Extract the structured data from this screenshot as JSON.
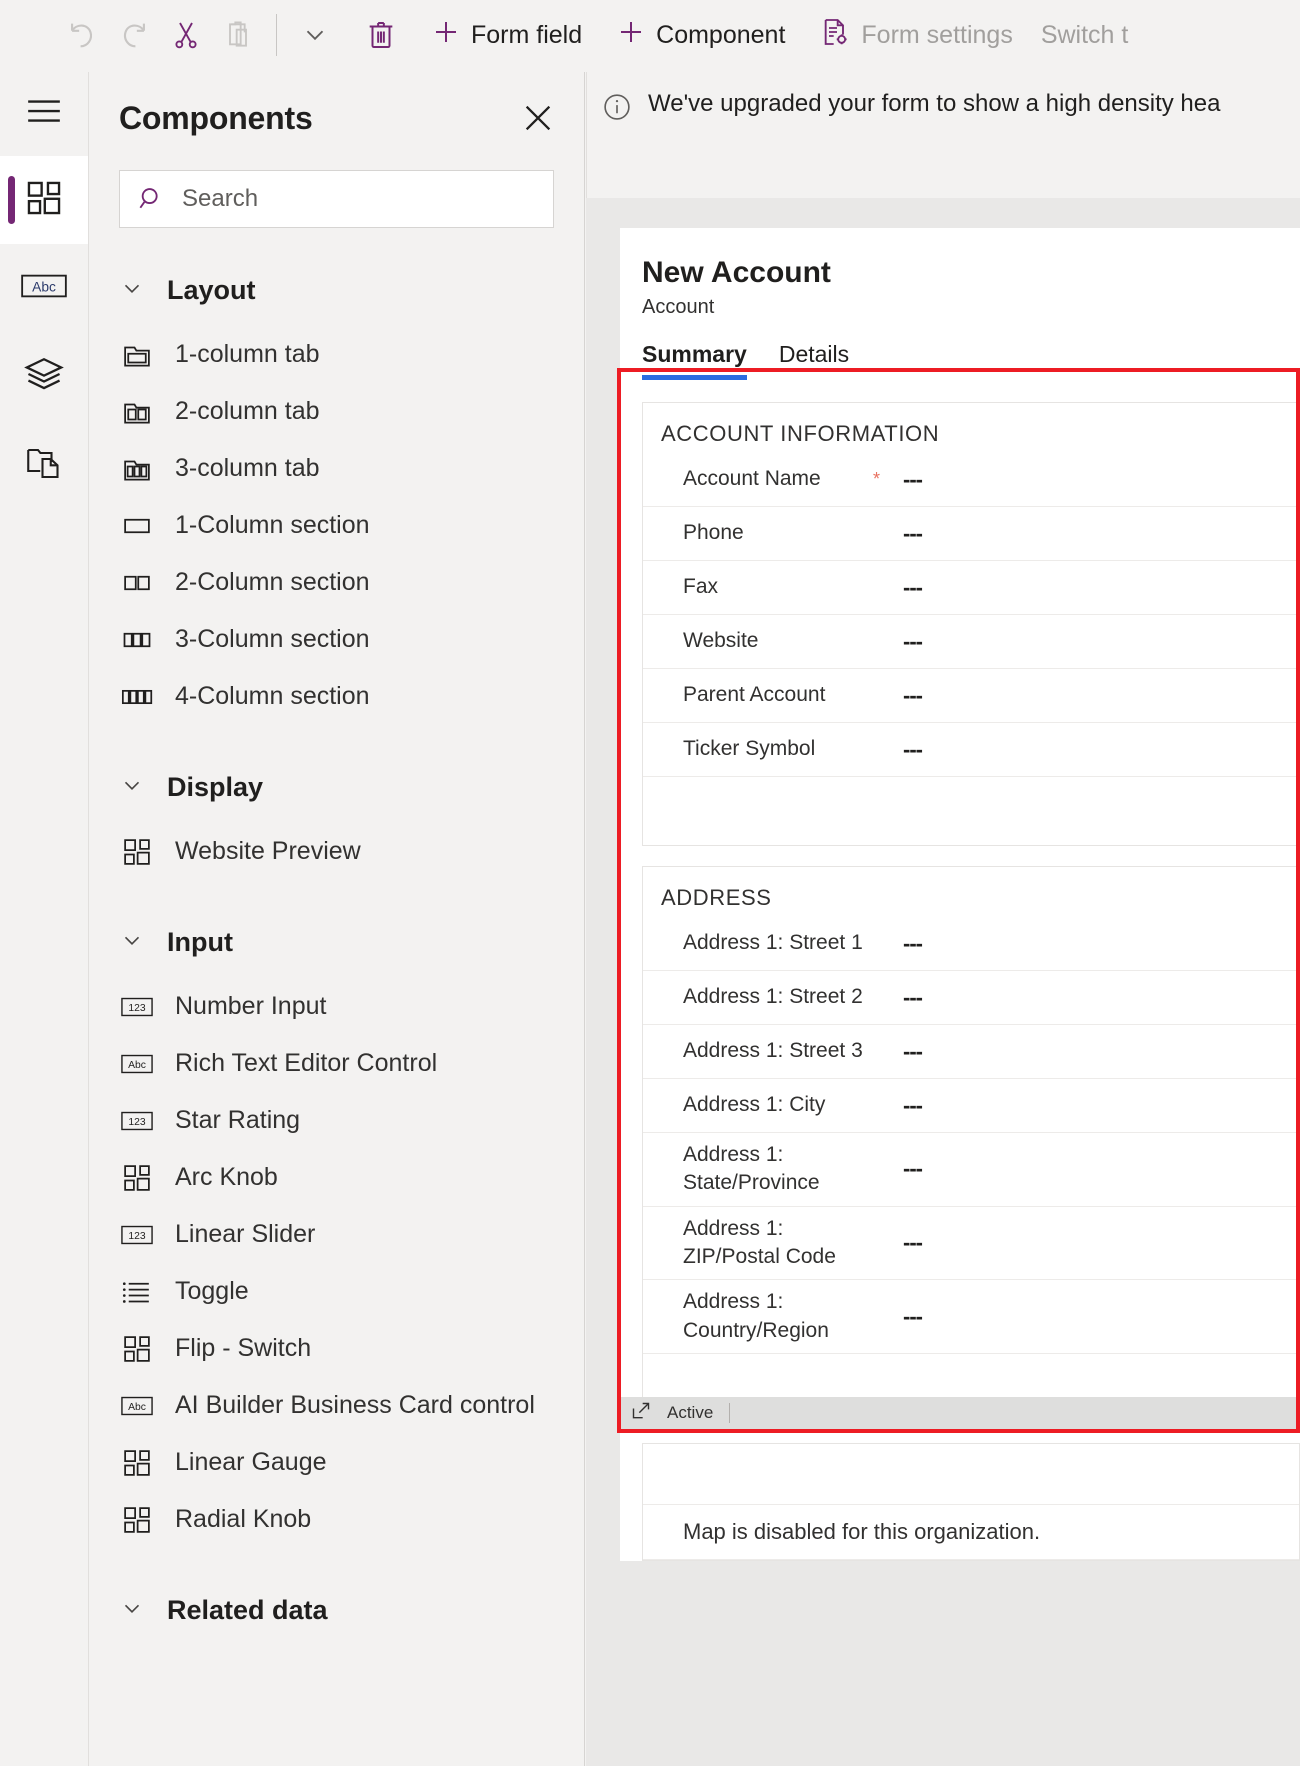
{
  "commandbar": {
    "items": [
      {
        "name": "undo",
        "icon": "undo-icon",
        "label": "",
        "disabled": true
      },
      {
        "name": "redo",
        "icon": "redo-icon",
        "label": "",
        "disabled": true
      },
      {
        "name": "cut",
        "icon": "scissors-icon",
        "label": "",
        "disabled": false
      },
      {
        "name": "paste",
        "icon": "clipboard-icon",
        "label": "",
        "disabled": true
      },
      {
        "name": "overflow",
        "icon": "chevron-down-icon",
        "label": "",
        "disabled": false
      },
      {
        "name": "delete",
        "icon": "trash-icon",
        "label": "",
        "disabled": false
      }
    ],
    "form_field_label": "Form field",
    "component_label": "Component",
    "form_settings_label": "Form settings",
    "switch_label": "Switch t"
  },
  "rail": {
    "items": [
      {
        "name": "hamburger",
        "icon": "hamburger-icon",
        "active": false
      },
      {
        "name": "components",
        "icon": "components-grid-icon",
        "active": true
      },
      {
        "name": "fields",
        "icon": "abc-box-icon",
        "active": false
      },
      {
        "name": "tree-view",
        "icon": "layers-icon",
        "active": false
      },
      {
        "name": "form-library",
        "icon": "copy-folder-icon",
        "active": false
      }
    ]
  },
  "panel": {
    "title": "Components",
    "close_label": "",
    "search": {
      "placeholder": "Search",
      "value": ""
    },
    "groups": [
      {
        "title": "Layout",
        "items": [
          {
            "label": "1-column tab",
            "icon": "tab-1col-icon"
          },
          {
            "label": "2-column tab",
            "icon": "tab-2col-icon"
          },
          {
            "label": "3-column tab",
            "icon": "tab-3col-icon"
          },
          {
            "label": "1-Column section",
            "icon": "section-1col-icon"
          },
          {
            "label": "2-Column section",
            "icon": "section-2col-icon"
          },
          {
            "label": "3-Column section",
            "icon": "section-3col-icon"
          },
          {
            "label": "4-Column section",
            "icon": "section-4col-icon"
          }
        ]
      },
      {
        "title": "Display",
        "items": [
          {
            "label": "Website Preview",
            "icon": "components-grid-icon"
          }
        ]
      },
      {
        "title": "Input",
        "items": [
          {
            "label": "Number Input",
            "icon": "numeric-123-icon"
          },
          {
            "label": "Rich Text Editor Control",
            "icon": "abc-box-icon"
          },
          {
            "label": "Star Rating",
            "icon": "numeric-123-icon"
          },
          {
            "label": "Arc Knob",
            "icon": "components-grid-icon"
          },
          {
            "label": "Linear Slider",
            "icon": "numeric-123-icon"
          },
          {
            "label": "Toggle",
            "icon": "list-lines-icon"
          },
          {
            "label": "Flip - Switch",
            "icon": "components-grid-icon"
          },
          {
            "label": "AI Builder Business Card control",
            "icon": "abc-box-icon"
          },
          {
            "label": "Linear Gauge",
            "icon": "components-grid-icon"
          },
          {
            "label": "Radial Knob",
            "icon": "components-grid-icon"
          }
        ]
      },
      {
        "title": "Related data",
        "items": []
      }
    ]
  },
  "canvas": {
    "notification": {
      "icon": "info-circle-icon",
      "text": "We've upgraded your form to show a high density hea"
    },
    "form": {
      "title": "New Account",
      "subtitle": "Account",
      "tabs": [
        {
          "label": "Summary",
          "active": true
        },
        {
          "label": "Details",
          "active": false
        }
      ],
      "sections": [
        {
          "title": "ACCOUNT INFORMATION",
          "rows": [
            {
              "label": "Account Name",
              "required": "*",
              "value": "---"
            },
            {
              "label": "Phone",
              "required": "",
              "value": "---"
            },
            {
              "label": "Fax",
              "required": "",
              "value": "---"
            },
            {
              "label": "Website",
              "required": "",
              "value": "---"
            },
            {
              "label": "Parent Account",
              "required": "",
              "value": "---"
            },
            {
              "label": "Ticker Symbol",
              "required": "",
              "value": "---"
            }
          ]
        },
        {
          "title": "ADDRESS",
          "rows": [
            {
              "label": "Address 1: Street 1",
              "required": "",
              "value": "---"
            },
            {
              "label": "Address 1: Street 2",
              "required": "",
              "value": "---"
            },
            {
              "label": "Address 1: Street 3",
              "required": "",
              "value": "---"
            },
            {
              "label": "Address 1: City",
              "required": "",
              "value": "---"
            },
            {
              "label": "Address 1: State/Province",
              "required": "",
              "value": "---"
            },
            {
              "label": "Address 1: ZIP/Postal Code",
              "required": "",
              "value": "---"
            },
            {
              "label": "Address 1: Country/Region",
              "required": "",
              "value": "---"
            }
          ]
        }
      ],
      "map_message": "Map is disabled for this organization."
    },
    "statusbar": {
      "icon": "popout-icon",
      "state": "Active"
    }
  },
  "colors": {
    "accent_purple": "#742774",
    "tab_underline_blue": "#2b6ce0",
    "highlight_red": "#ed1c24",
    "required_red": "#e8705f",
    "panel_bg": "#f3f2f1",
    "canvas_bg": "#e9e8e7"
  }
}
